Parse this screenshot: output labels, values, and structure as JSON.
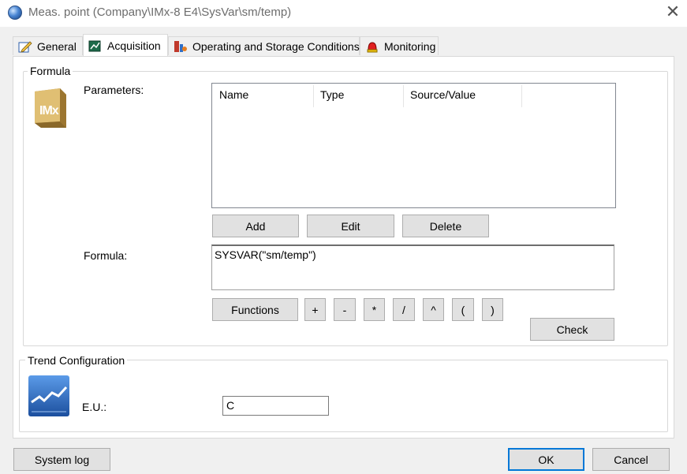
{
  "window": {
    "title": "Meas. point (Company\\IMx-8 E4\\SysVar\\sm/temp)",
    "close_glyph": "✕"
  },
  "tabs": [
    {
      "label": "General",
      "icon": "edit-icon"
    },
    {
      "label": "Acquisition",
      "icon": "acquisition-icon"
    },
    {
      "label": "Operating and Storage Conditions",
      "icon": "conditions-icon"
    },
    {
      "label": "Monitoring",
      "icon": "alarm-icon"
    }
  ],
  "formula_group": {
    "legend": "Formula",
    "logo_text": "IMx",
    "parameters_label": "Parameters:",
    "columns": [
      "Name",
      "Type",
      "Source/Value"
    ],
    "add_label": "Add",
    "edit_label": "Edit",
    "delete_label": "Delete",
    "formula_label": "Formula:",
    "formula_value": "SYSVAR(\"sm/temp\")",
    "functions_label": "Functions",
    "operators": [
      "+",
      "-",
      "*",
      "/",
      "^",
      "(",
      ")"
    ],
    "check_label": "Check"
  },
  "trend_group": {
    "legend": "Trend Configuration",
    "eu_label": "E.U.:",
    "eu_value": "C"
  },
  "footer": {
    "system_log_label": "System log",
    "ok_label": "OK",
    "cancel_label": "Cancel"
  },
  "colors": {
    "accent": "#0078d7",
    "logo_gold": "#c9a55a",
    "trend_blue": "#2e6fc8"
  }
}
